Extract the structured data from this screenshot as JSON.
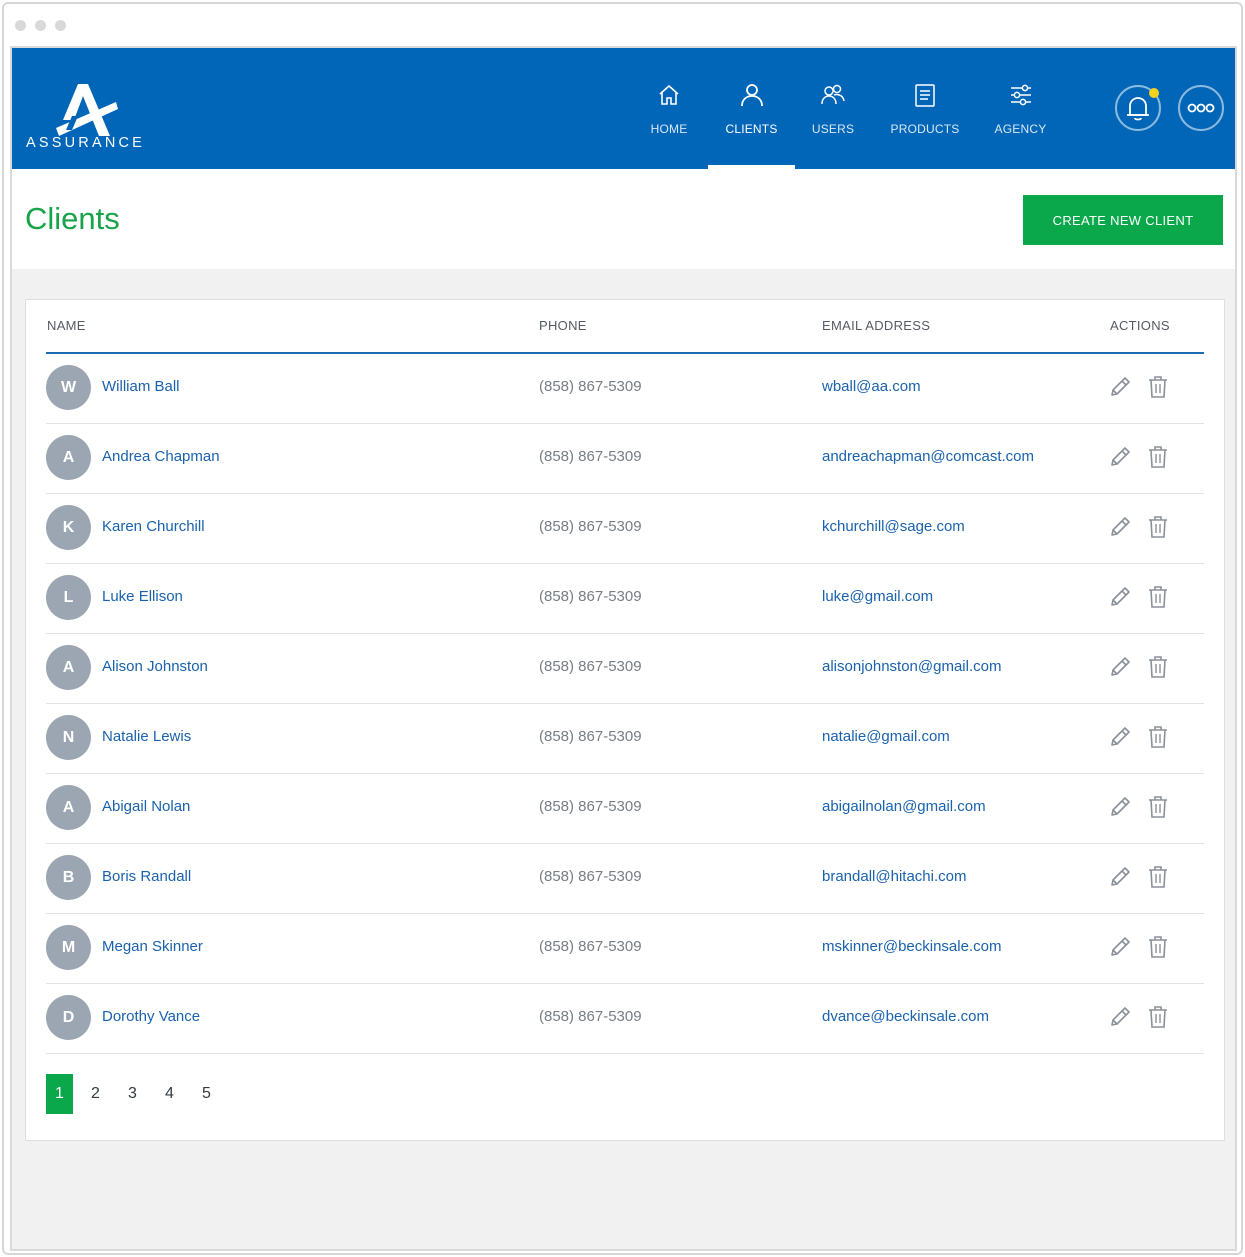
{
  "app": {
    "logo_text": "ASSURANCE",
    "brand_color": "#0166b8",
    "accent_color": "#0aa84a"
  },
  "nav": {
    "items": [
      {
        "label": "HOME",
        "icon": "home-icon"
      },
      {
        "label": "CLIENTS",
        "icon": "user-icon",
        "active": true
      },
      {
        "label": "USERS",
        "icon": "users-icon"
      },
      {
        "label": "PRODUCTS",
        "icon": "document-icon"
      },
      {
        "label": "AGENCY",
        "icon": "sliders-icon"
      }
    ],
    "notification_icon": "bell-icon",
    "more_icon": "more-icon"
  },
  "page": {
    "title": "Clients",
    "create_button": "CREATE NEW CLIENT"
  },
  "table": {
    "columns": {
      "name": "NAME",
      "phone": "PHONE",
      "email": "EMAIL ADDRESS",
      "actions": "ACTIONS"
    },
    "rows": [
      {
        "initial": "W",
        "name": "William Ball",
        "phone": "(858) 867-5309",
        "email": "wball@aa.com"
      },
      {
        "initial": "A",
        "name": "Andrea Chapman",
        "phone": "(858) 867-5309",
        "email": "andreachapman@comcast.com"
      },
      {
        "initial": "K",
        "name": "Karen Churchill",
        "phone": "(858) 867-5309",
        "email": "kchurchill@sage.com"
      },
      {
        "initial": "L",
        "name": "Luke Ellison",
        "phone": "(858) 867-5309",
        "email": "luke@gmail.com"
      },
      {
        "initial": "A",
        "name": "Alison Johnston",
        "phone": "(858) 867-5309",
        "email": "alisonjohnston@gmail.com"
      },
      {
        "initial": "N",
        "name": "Natalie Lewis",
        "phone": "(858) 867-5309",
        "email": "natalie@gmail.com"
      },
      {
        "initial": "A",
        "name": "Abigail  Nolan",
        "phone": "(858) 867-5309",
        "email": "abigailnolan@gmail.com"
      },
      {
        "initial": "B",
        "name": "Boris Randall",
        "phone": "(858) 867-5309",
        "email": "brandall@hitachi.com"
      },
      {
        "initial": "M",
        "name": "Megan Skinner",
        "phone": "(858) 867-5309",
        "email": "mskinner@beckinsale.com"
      },
      {
        "initial": "D",
        "name": "Dorothy Vance",
        "phone": "(858) 867-5309",
        "email": "dvance@beckinsale.com"
      }
    ]
  },
  "pagination": {
    "pages": [
      "1",
      "2",
      "3",
      "4",
      "5"
    ],
    "current": "1"
  }
}
